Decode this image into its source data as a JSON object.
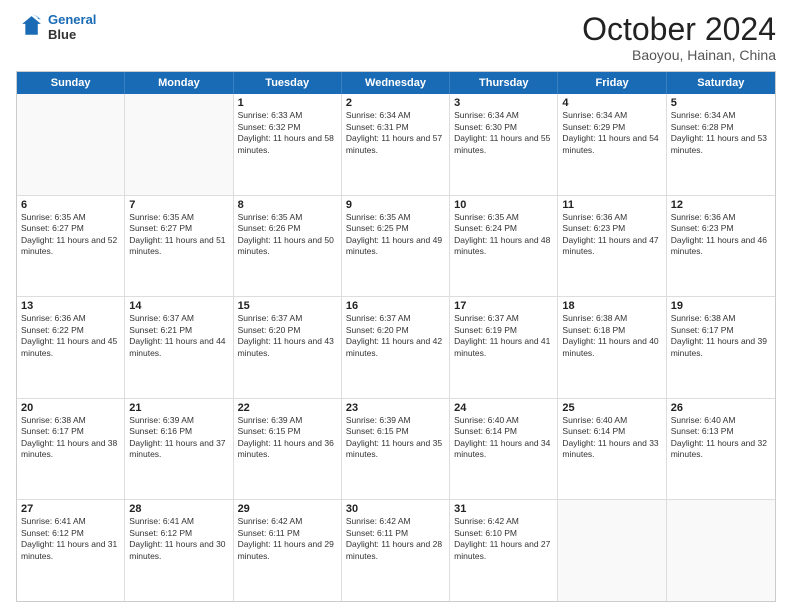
{
  "header": {
    "logo_line1": "General",
    "logo_line2": "Blue",
    "title": "October 2024",
    "subtitle": "Baoyou, Hainan, China"
  },
  "weekdays": [
    "Sunday",
    "Monday",
    "Tuesday",
    "Wednesday",
    "Thursday",
    "Friday",
    "Saturday"
  ],
  "weeks": [
    [
      {
        "day": "",
        "sunrise": "",
        "sunset": "",
        "daylight": ""
      },
      {
        "day": "",
        "sunrise": "",
        "sunset": "",
        "daylight": ""
      },
      {
        "day": "1",
        "sunrise": "Sunrise: 6:33 AM",
        "sunset": "Sunset: 6:32 PM",
        "daylight": "Daylight: 11 hours and 58 minutes."
      },
      {
        "day": "2",
        "sunrise": "Sunrise: 6:34 AM",
        "sunset": "Sunset: 6:31 PM",
        "daylight": "Daylight: 11 hours and 57 minutes."
      },
      {
        "day": "3",
        "sunrise": "Sunrise: 6:34 AM",
        "sunset": "Sunset: 6:30 PM",
        "daylight": "Daylight: 11 hours and 55 minutes."
      },
      {
        "day": "4",
        "sunrise": "Sunrise: 6:34 AM",
        "sunset": "Sunset: 6:29 PM",
        "daylight": "Daylight: 11 hours and 54 minutes."
      },
      {
        "day": "5",
        "sunrise": "Sunrise: 6:34 AM",
        "sunset": "Sunset: 6:28 PM",
        "daylight": "Daylight: 11 hours and 53 minutes."
      }
    ],
    [
      {
        "day": "6",
        "sunrise": "Sunrise: 6:35 AM",
        "sunset": "Sunset: 6:27 PM",
        "daylight": "Daylight: 11 hours and 52 minutes."
      },
      {
        "day": "7",
        "sunrise": "Sunrise: 6:35 AM",
        "sunset": "Sunset: 6:27 PM",
        "daylight": "Daylight: 11 hours and 51 minutes."
      },
      {
        "day": "8",
        "sunrise": "Sunrise: 6:35 AM",
        "sunset": "Sunset: 6:26 PM",
        "daylight": "Daylight: 11 hours and 50 minutes."
      },
      {
        "day": "9",
        "sunrise": "Sunrise: 6:35 AM",
        "sunset": "Sunset: 6:25 PM",
        "daylight": "Daylight: 11 hours and 49 minutes."
      },
      {
        "day": "10",
        "sunrise": "Sunrise: 6:35 AM",
        "sunset": "Sunset: 6:24 PM",
        "daylight": "Daylight: 11 hours and 48 minutes."
      },
      {
        "day": "11",
        "sunrise": "Sunrise: 6:36 AM",
        "sunset": "Sunset: 6:23 PM",
        "daylight": "Daylight: 11 hours and 47 minutes."
      },
      {
        "day": "12",
        "sunrise": "Sunrise: 6:36 AM",
        "sunset": "Sunset: 6:23 PM",
        "daylight": "Daylight: 11 hours and 46 minutes."
      }
    ],
    [
      {
        "day": "13",
        "sunrise": "Sunrise: 6:36 AM",
        "sunset": "Sunset: 6:22 PM",
        "daylight": "Daylight: 11 hours and 45 minutes."
      },
      {
        "day": "14",
        "sunrise": "Sunrise: 6:37 AM",
        "sunset": "Sunset: 6:21 PM",
        "daylight": "Daylight: 11 hours and 44 minutes."
      },
      {
        "day": "15",
        "sunrise": "Sunrise: 6:37 AM",
        "sunset": "Sunset: 6:20 PM",
        "daylight": "Daylight: 11 hours and 43 minutes."
      },
      {
        "day": "16",
        "sunrise": "Sunrise: 6:37 AM",
        "sunset": "Sunset: 6:20 PM",
        "daylight": "Daylight: 11 hours and 42 minutes."
      },
      {
        "day": "17",
        "sunrise": "Sunrise: 6:37 AM",
        "sunset": "Sunset: 6:19 PM",
        "daylight": "Daylight: 11 hours and 41 minutes."
      },
      {
        "day": "18",
        "sunrise": "Sunrise: 6:38 AM",
        "sunset": "Sunset: 6:18 PM",
        "daylight": "Daylight: 11 hours and 40 minutes."
      },
      {
        "day": "19",
        "sunrise": "Sunrise: 6:38 AM",
        "sunset": "Sunset: 6:17 PM",
        "daylight": "Daylight: 11 hours and 39 minutes."
      }
    ],
    [
      {
        "day": "20",
        "sunrise": "Sunrise: 6:38 AM",
        "sunset": "Sunset: 6:17 PM",
        "daylight": "Daylight: 11 hours and 38 minutes."
      },
      {
        "day": "21",
        "sunrise": "Sunrise: 6:39 AM",
        "sunset": "Sunset: 6:16 PM",
        "daylight": "Daylight: 11 hours and 37 minutes."
      },
      {
        "day": "22",
        "sunrise": "Sunrise: 6:39 AM",
        "sunset": "Sunset: 6:15 PM",
        "daylight": "Daylight: 11 hours and 36 minutes."
      },
      {
        "day": "23",
        "sunrise": "Sunrise: 6:39 AM",
        "sunset": "Sunset: 6:15 PM",
        "daylight": "Daylight: 11 hours and 35 minutes."
      },
      {
        "day": "24",
        "sunrise": "Sunrise: 6:40 AM",
        "sunset": "Sunset: 6:14 PM",
        "daylight": "Daylight: 11 hours and 34 minutes."
      },
      {
        "day": "25",
        "sunrise": "Sunrise: 6:40 AM",
        "sunset": "Sunset: 6:14 PM",
        "daylight": "Daylight: 11 hours and 33 minutes."
      },
      {
        "day": "26",
        "sunrise": "Sunrise: 6:40 AM",
        "sunset": "Sunset: 6:13 PM",
        "daylight": "Daylight: 11 hours and 32 minutes."
      }
    ],
    [
      {
        "day": "27",
        "sunrise": "Sunrise: 6:41 AM",
        "sunset": "Sunset: 6:12 PM",
        "daylight": "Daylight: 11 hours and 31 minutes."
      },
      {
        "day": "28",
        "sunrise": "Sunrise: 6:41 AM",
        "sunset": "Sunset: 6:12 PM",
        "daylight": "Daylight: 11 hours and 30 minutes."
      },
      {
        "day": "29",
        "sunrise": "Sunrise: 6:42 AM",
        "sunset": "Sunset: 6:11 PM",
        "daylight": "Daylight: 11 hours and 29 minutes."
      },
      {
        "day": "30",
        "sunrise": "Sunrise: 6:42 AM",
        "sunset": "Sunset: 6:11 PM",
        "daylight": "Daylight: 11 hours and 28 minutes."
      },
      {
        "day": "31",
        "sunrise": "Sunrise: 6:42 AM",
        "sunset": "Sunset: 6:10 PM",
        "daylight": "Daylight: 11 hours and 27 minutes."
      },
      {
        "day": "",
        "sunrise": "",
        "sunset": "",
        "daylight": ""
      },
      {
        "day": "",
        "sunrise": "",
        "sunset": "",
        "daylight": ""
      }
    ]
  ]
}
